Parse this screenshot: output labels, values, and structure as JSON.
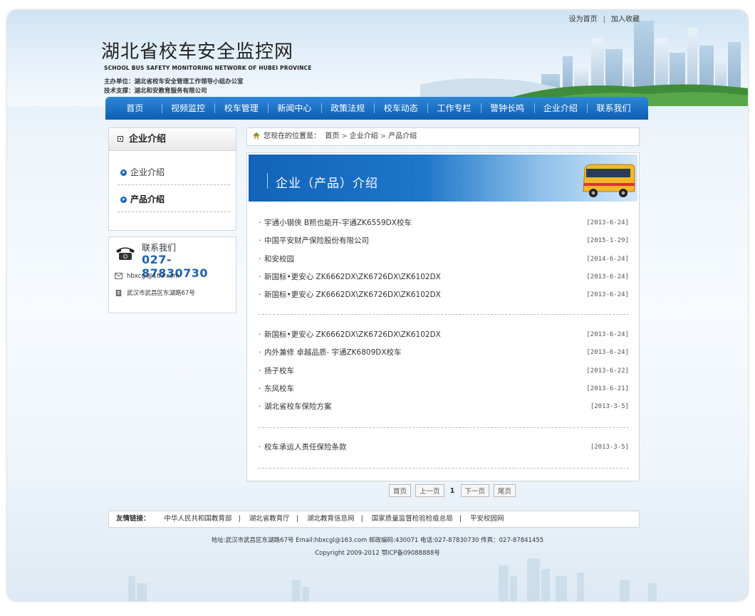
{
  "top_links": [
    "设为首页",
    "加入收藏"
  ],
  "site": {
    "title": "湖北省校车安全监控网",
    "subtitle_en": "SCHOOL BUS SAFETY MONITORING NETWORK OF HUBEI PROVINCE",
    "host": "主办单位：湖北省校车安全管理工作领导小组办公室",
    "tech": "技术支撑：湖北和安教育服务有限公司"
  },
  "nav": [
    "首页",
    "视频监控",
    "校车管理",
    "新闻中心",
    "政策法规",
    "校车动态",
    "工作专栏",
    "警钟长鸣",
    "企业介绍",
    "联系我们"
  ],
  "sidebar": {
    "title": "企业介绍",
    "items": [
      {
        "label": "企业介绍"
      },
      {
        "label": "产品介绍"
      }
    ]
  },
  "contact": {
    "title": "联系我们",
    "tel": "027-87830730",
    "email": "hbxcgl@163.com",
    "address": "武汉市武昌区东湖路67号"
  },
  "breadcrumb": {
    "prefix": "您现在的位置是：",
    "items": [
      "首页",
      "企业介绍",
      "产品介绍"
    ]
  },
  "banner": {
    "title": "企业（产品）介绍"
  },
  "news_groups": [
    [
      {
        "title": "宇通小钢侠 B照也能开-宇通ZK6559DX校车",
        "date": "[2013-6-24]"
      },
      {
        "title": "中国平安财产保险股份有限公司",
        "date": "[2015-1-29]"
      },
      {
        "title": "和安校园",
        "date": "[2014-6-24]"
      },
      {
        "title": "新国标•更安心 ZK6662DX\\ZK6726DX\\ZK6102DX",
        "date": "[2013-6-24]"
      },
      {
        "title": "新国标•更安心 ZK6662DX\\ZK6726DX\\ZK6102DX",
        "date": "[2013-6-24]"
      }
    ],
    [
      {
        "title": "新国标•更安心 ZK6662DX\\ZK6726DX\\ZK6102DX",
        "date": "[2013-6-24]"
      },
      {
        "title": "内外兼修 卓越品质- 宇通ZK6809DX校车",
        "date": "[2013-6-24]"
      },
      {
        "title": "扬子校车",
        "date": "[2013-6-22]"
      },
      {
        "title": "东风校车",
        "date": "[2013-6-21]"
      },
      {
        "title": "湖北省校车保险方案",
        "date": "[2013-3-5]"
      }
    ],
    [
      {
        "title": "校车承运人责任保险条款",
        "date": "[2013-3-5]"
      }
    ]
  ],
  "pager": {
    "first": "首页",
    "prev": "上一页",
    "current": "1",
    "next": "下一页",
    "last": "尾页"
  },
  "friend_links": {
    "label": "友情链接：",
    "items": [
      "中华人民共和国教育部",
      "湖北省教育厅",
      "湖北教育信息网",
      "国家质量监督检验检疫总局",
      "平安校园网"
    ]
  },
  "footer": {
    "line1": "地址:武汉市武昌区东湖路67号 Email:hbxcgl@163.com 邮政编码:430071 电话:027-87830730 传真：027-87841455",
    "line2": "Copyright 2009-2012 鄂ICP备09088888号"
  },
  "colors": {
    "accent": "#1d62b3",
    "nav": "#0e5eb3"
  }
}
